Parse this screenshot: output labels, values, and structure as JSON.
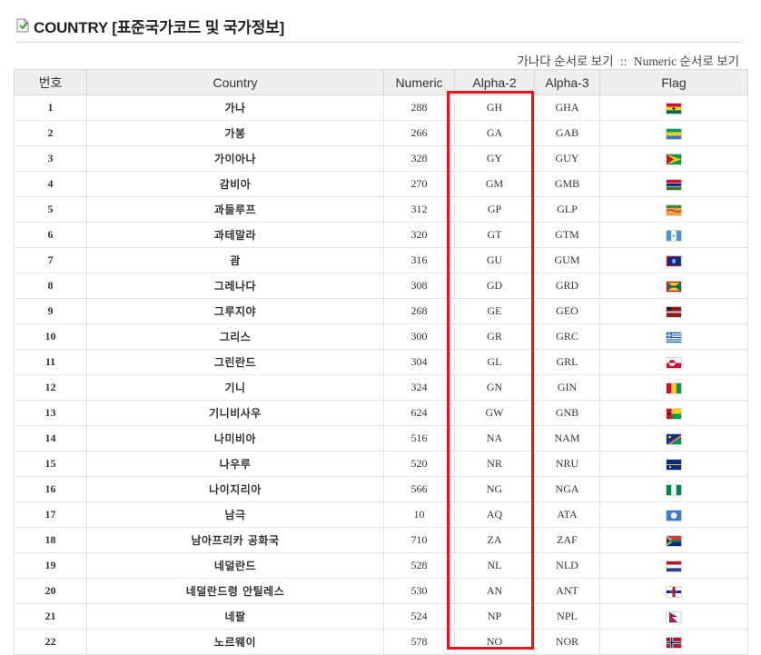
{
  "header": {
    "title": "COUNTRY [표준국가코드 및 국가정보]",
    "sort_hangul": "가나다 순서로 보기",
    "sort_separator": "::",
    "sort_numeric": "Numeric 순서로 보기"
  },
  "table": {
    "columns": [
      "번호",
      "Country",
      "Numeric",
      "Alpha-2",
      "Alpha-3",
      "Flag"
    ],
    "rows": [
      {
        "no": "1",
        "country": "가나",
        "numeric": "288",
        "alpha2": "GH",
        "alpha3": "GHA",
        "flag": "gh"
      },
      {
        "no": "2",
        "country": "가봉",
        "numeric": "266",
        "alpha2": "GA",
        "alpha3": "GAB",
        "flag": "ga"
      },
      {
        "no": "3",
        "country": "가이아나",
        "numeric": "328",
        "alpha2": "GY",
        "alpha3": "GUY",
        "flag": "gy"
      },
      {
        "no": "4",
        "country": "감비아",
        "numeric": "270",
        "alpha2": "GM",
        "alpha3": "GMB",
        "flag": "gm"
      },
      {
        "no": "5",
        "country": "과들루프",
        "numeric": "312",
        "alpha2": "GP",
        "alpha3": "GLP",
        "flag": "gp"
      },
      {
        "no": "6",
        "country": "과테말라",
        "numeric": "320",
        "alpha2": "GT",
        "alpha3": "GTM",
        "flag": "gt"
      },
      {
        "no": "7",
        "country": "괌",
        "numeric": "316",
        "alpha2": "GU",
        "alpha3": "GUM",
        "flag": "gu"
      },
      {
        "no": "8",
        "country": "그레나다",
        "numeric": "308",
        "alpha2": "GD",
        "alpha3": "GRD",
        "flag": "gd"
      },
      {
        "no": "9",
        "country": "그루지야",
        "numeric": "268",
        "alpha2": "GE",
        "alpha3": "GEO",
        "flag": "ge"
      },
      {
        "no": "10",
        "country": "그리스",
        "numeric": "300",
        "alpha2": "GR",
        "alpha3": "GRC",
        "flag": "gr"
      },
      {
        "no": "11",
        "country": "그린란드",
        "numeric": "304",
        "alpha2": "GL",
        "alpha3": "GRL",
        "flag": "gl"
      },
      {
        "no": "12",
        "country": "기니",
        "numeric": "324",
        "alpha2": "GN",
        "alpha3": "GIN",
        "flag": "gn"
      },
      {
        "no": "13",
        "country": "기니비사우",
        "numeric": "624",
        "alpha2": "GW",
        "alpha3": "GNB",
        "flag": "gw"
      },
      {
        "no": "14",
        "country": "나미비아",
        "numeric": "516",
        "alpha2": "NA",
        "alpha3": "NAM",
        "flag": "na"
      },
      {
        "no": "15",
        "country": "나우루",
        "numeric": "520",
        "alpha2": "NR",
        "alpha3": "NRU",
        "flag": "nr"
      },
      {
        "no": "16",
        "country": "나이지리아",
        "numeric": "566",
        "alpha2": "NG",
        "alpha3": "NGA",
        "flag": "ng"
      },
      {
        "no": "17",
        "country": "남극",
        "numeric": "10",
        "alpha2": "AQ",
        "alpha3": "ATA",
        "flag": "aq"
      },
      {
        "no": "18",
        "country": "남아프리카 공화국",
        "numeric": "710",
        "alpha2": "ZA",
        "alpha3": "ZAF",
        "flag": "za"
      },
      {
        "no": "19",
        "country": "네덜란드",
        "numeric": "528",
        "alpha2": "NL",
        "alpha3": "NLD",
        "flag": "nl"
      },
      {
        "no": "20",
        "country": "네덜란드령 안틸레스",
        "numeric": "530",
        "alpha2": "AN",
        "alpha3": "ANT",
        "flag": "an"
      },
      {
        "no": "21",
        "country": "네팔",
        "numeric": "524",
        "alpha2": "NP",
        "alpha3": "NPL",
        "flag": "np"
      },
      {
        "no": "22",
        "country": "노르웨이",
        "numeric": "578",
        "alpha2": "NO",
        "alpha3": "NOR",
        "flag": "no"
      }
    ]
  },
  "colors": {
    "highlight": "#e8141b",
    "header_bg": "#eeeeee",
    "border": "#d9d9d9"
  }
}
